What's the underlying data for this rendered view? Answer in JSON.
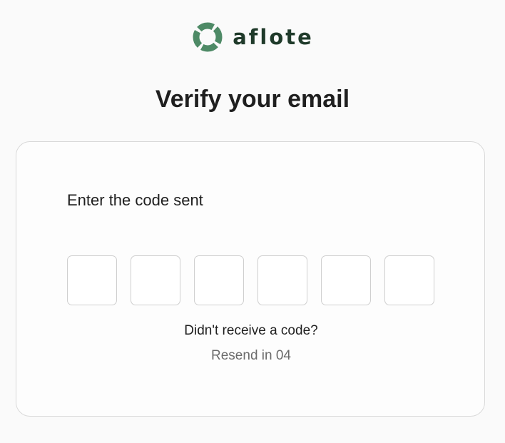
{
  "brand": {
    "name": "aflote",
    "colors": {
      "ring": "#4e8a66",
      "text": "#1f3a2a"
    }
  },
  "page": {
    "title": "Verify your email"
  },
  "card": {
    "instruction": "Enter the code sent",
    "code_inputs": [
      "",
      "",
      "",
      "",
      "",
      ""
    ],
    "didnt_receive": "Didn't receive a code?",
    "resend_countdown": "Resend in 04"
  }
}
